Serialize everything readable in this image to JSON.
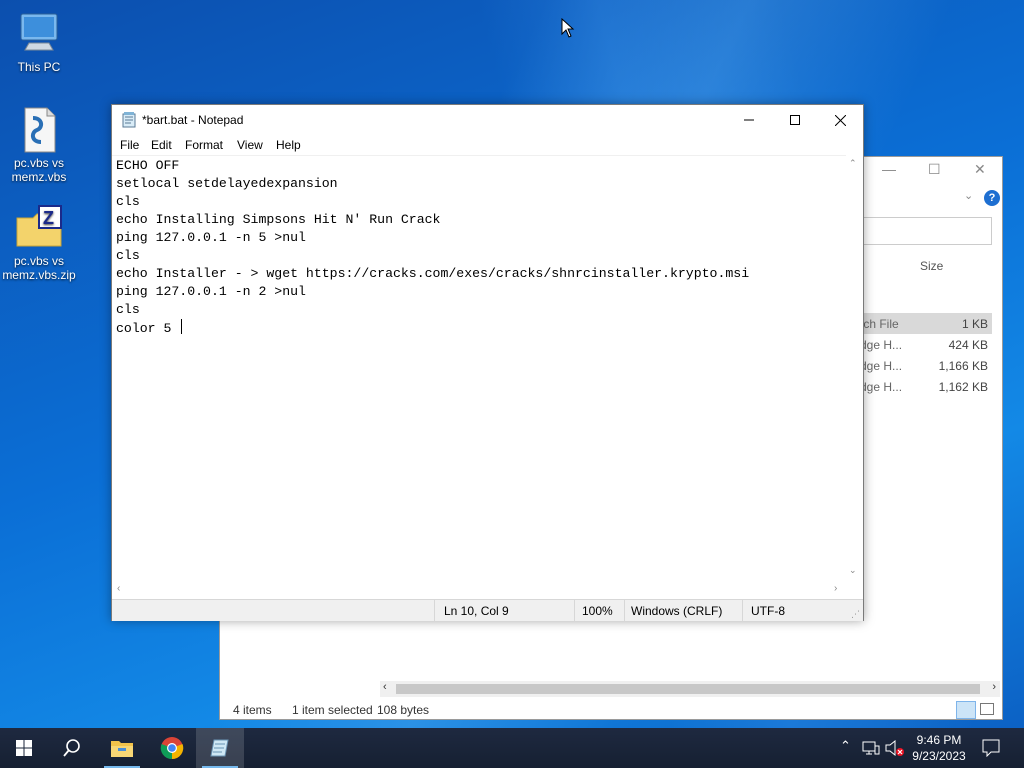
{
  "desktop": {
    "icons": [
      {
        "label": "This PC"
      },
      {
        "label": "pc.vbs vs memz.vbs"
      },
      {
        "label": "pc.vbs vs memz.vbs.zip"
      }
    ]
  },
  "explorer": {
    "column_size": "Size",
    "rows": [
      {
        "type": "tch File",
        "size": "1 KB",
        "selected": true
      },
      {
        "type": "dge H...",
        "size": "424 KB"
      },
      {
        "type": "dge H...",
        "size": "1,166 KB"
      },
      {
        "type": "dge H...",
        "size": "1,162 KB"
      }
    ],
    "status": {
      "items": "4 items",
      "selected": "1 item selected",
      "bytes": "108 bytes"
    }
  },
  "notepad": {
    "title": "*bart.bat - Notepad",
    "menu": [
      "File",
      "Edit",
      "Format",
      "View",
      "Help"
    ],
    "lines": [
      "ECHO OFF",
      "setlocal setdelayedexpansion",
      "cls",
      "echo Installing Simpsons Hit N' Run Crack",
      "ping 127.0.0.1 -n 5 >nul",
      "cls",
      "echo Installer - > wget https://cracks.com/exes/cracks/shnrcinstaller.krypto.msi",
      "ping 127.0.0.1 -n 2 >nul",
      "cls",
      "color 5 "
    ],
    "status": {
      "position": "Ln 10, Col 9",
      "zoom": "100%",
      "line_ending": "Windows (CRLF)",
      "encoding": "UTF-8"
    }
  },
  "taskbar": {
    "clock_time": "9:46 PM",
    "clock_date": "9/23/2023",
    "apps": [
      "start",
      "search",
      "file-explorer",
      "chrome",
      "notepad"
    ]
  },
  "colors": {
    "desktop_blue": "#0b6fd6",
    "taskbar": "#1b2433",
    "selection_gray": "#d9d9d9",
    "scroll_accent": "#76b9ed"
  }
}
